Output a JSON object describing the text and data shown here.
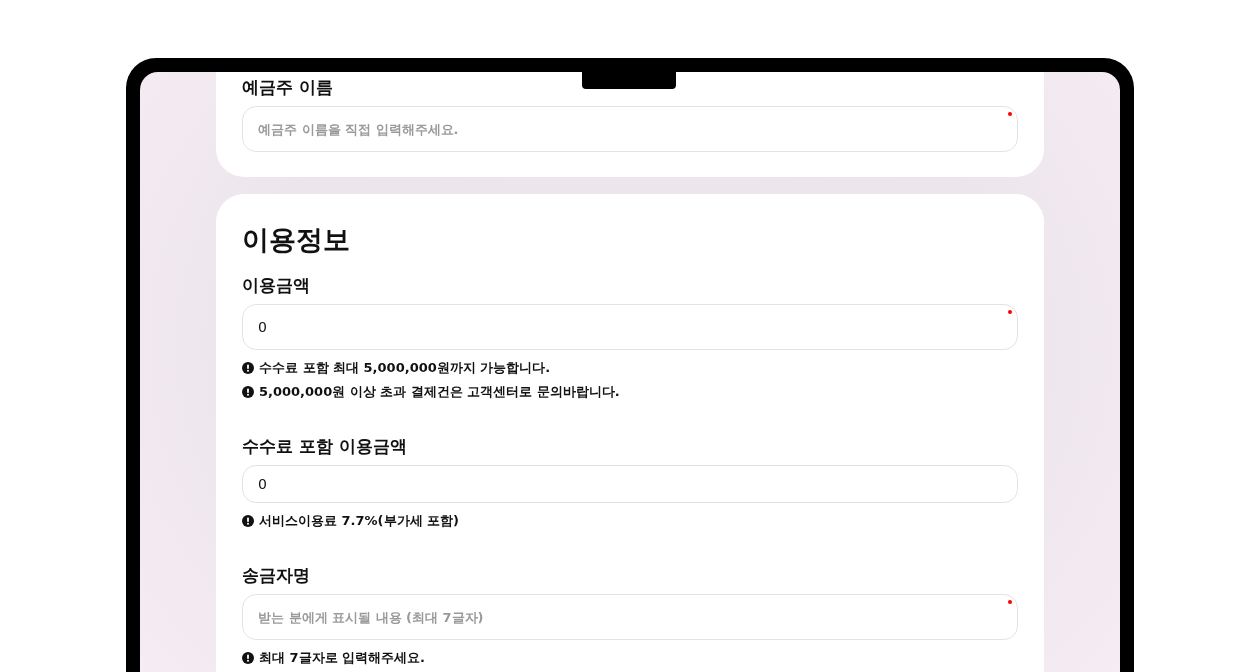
{
  "sections": [
    {
      "fields": [
        {
          "kind": "input",
          "label": "예금주 이름",
          "placeholder": "예금주 이름을 직접 입력해주세요.",
          "required": true
        }
      ]
    },
    {
      "title": "이용정보",
      "fields": [
        {
          "kind": "input",
          "label": "이용금액",
          "value": "0",
          "required": true,
          "notes": [
            "수수료 포함 최대 5,000,000원까지 가능합니다.",
            "5,000,000원 이상 초과 결제건은 고객센터로 문의바랍니다."
          ]
        },
        {
          "kind": "readonly",
          "label": "수수료 포함 이용금액",
          "value": "0",
          "required": false,
          "notes": [
            "서비스이용료 7.7%(부가세 포함)"
          ]
        },
        {
          "kind": "input",
          "label": "송금자명",
          "placeholder": "받는 분에게 표시될 내용 (최대 7글자)",
          "required": true,
          "notes": [
            "최대 7글자로 입력해주세요."
          ]
        }
      ]
    }
  ]
}
